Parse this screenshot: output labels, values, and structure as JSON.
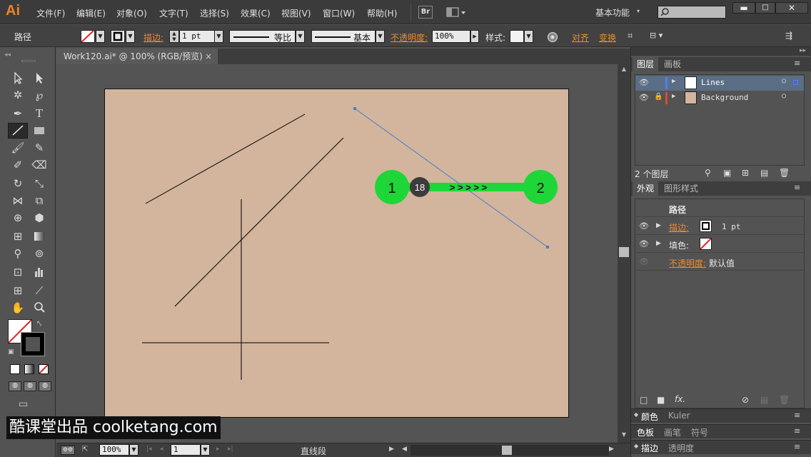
{
  "app": {
    "logo": "Ai"
  },
  "menu": [
    "文件(F)",
    "编辑(E)",
    "对象(O)",
    "文字(T)",
    "选择(S)",
    "效果(C)",
    "视图(V)",
    "窗口(W)",
    "帮助(H)"
  ],
  "topbar": {
    "bridge": "Br",
    "workspace": "基本功能"
  },
  "control": {
    "object_type": "路径",
    "stroke_label": "描边:",
    "stroke_weight": "1 pt",
    "profile_label": "等比",
    "brush_label": "基本",
    "opacity_label": "不透明度:",
    "opacity_value": "100%",
    "style_label": "样式:",
    "align_label": "对齐",
    "transform_label": "变换"
  },
  "document": {
    "tab_title": "Work120.ai* @ 100% (RGB/预览)",
    "close": "×"
  },
  "markers": {
    "one": "1",
    "two": "2",
    "count": "18",
    "arrows": "> > > > >"
  },
  "status": {
    "zoom": "100%",
    "page": "1",
    "tool_name": "直线段"
  },
  "layers_panel": {
    "tabs": [
      "图层",
      "画板"
    ],
    "layers": [
      {
        "name": "Lines",
        "color": "#4f7fff"
      },
      {
        "name": "Background",
        "color": "#e0463c"
      }
    ],
    "count": "2 个图层"
  },
  "appearance_panel": {
    "tabs": [
      "外观",
      "图形样式"
    ],
    "title": "路径",
    "stroke_label": "描边:",
    "stroke_value": "1 pt",
    "fill_label": "填色:",
    "opacity_label": "不透明度:",
    "opacity_value": "默认值",
    "fx": "fx."
  },
  "collapsed_panels": [
    {
      "tabs": [
        "颜色",
        "Kuler"
      ]
    },
    {
      "tabs": [
        "色板",
        "画笔",
        "符号"
      ]
    },
    {
      "tabs": [
        "描边",
        "透明度"
      ]
    }
  ],
  "watermark": "酷课堂出品 coolketang.com",
  "colors": {
    "artboard": "#d2b59c",
    "marker_green": "#1ed637",
    "selection": "#4a7fc8",
    "accent": "#e98b2e"
  }
}
